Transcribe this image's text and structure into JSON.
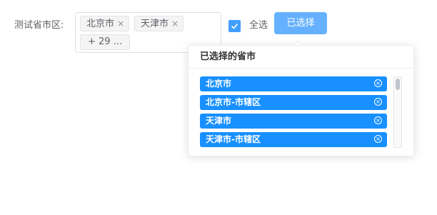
{
  "form": {
    "label": "测试省市区:"
  },
  "selector": {
    "tags": [
      {
        "label": "北京市",
        "close": "×"
      },
      {
        "label": "天津市",
        "close": "×"
      }
    ],
    "more": "+ 29 ..."
  },
  "select_all": {
    "checked": true,
    "label": "全选"
  },
  "select_button": {
    "label": "已选择"
  },
  "popover": {
    "title": "已选择的省市",
    "items": [
      {
        "label": "北京市",
        "close": "×"
      },
      {
        "label": "北京市-市辖区",
        "close": "×"
      },
      {
        "label": "天津市",
        "close": "×"
      },
      {
        "label": "天津市-市辖区",
        "close": "×"
      }
    ]
  },
  "colors": {
    "primary": "#409eff",
    "button": "#66b1ff",
    "item_bg": "#1890ff"
  }
}
